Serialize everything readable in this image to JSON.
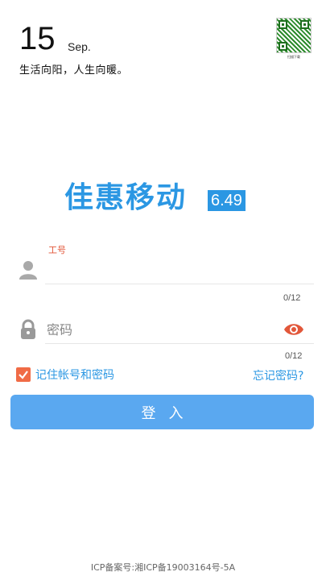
{
  "header": {
    "day": "15",
    "month": "Sep.",
    "slogan": "生活向阳，人生向暖。",
    "qr_caption": "扫描下载"
  },
  "brand": {
    "name": "佳惠移动",
    "version": "6.49",
    "color": "#2b97e3"
  },
  "form": {
    "username": {
      "label": "工号",
      "value": "",
      "counter": "0/12",
      "icon": "user-icon"
    },
    "password": {
      "placeholder": "密码",
      "value": "",
      "counter": "0/12",
      "icon": "lock-icon",
      "toggle_icon": "eye-icon"
    },
    "remember_label": "记住帐号和密码",
    "remember_checked": true,
    "forgot_label": "忘记密码?",
    "login_label": "登入"
  },
  "footer": {
    "icp": "ICP备案号:湘ICP备19003164号-5A"
  }
}
